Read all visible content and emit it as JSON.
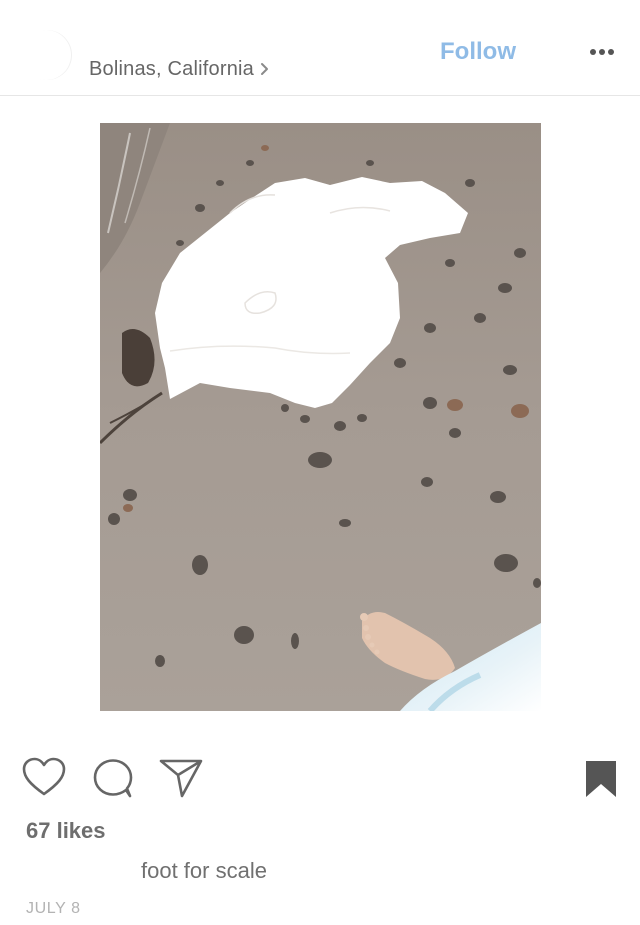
{
  "post": {
    "location": "Bolinas, California",
    "follow_label": "Follow",
    "more_icon": "more-dots-icon",
    "photo_description_icon": "beach-photo",
    "actions": {
      "like_icon": "heart-icon",
      "comment_icon": "comment-icon",
      "share_icon": "send-icon",
      "save_icon": "bookmark-icon"
    },
    "likes": "67 likes",
    "caption": "foot for scale",
    "date": "JULY 8"
  },
  "colors": {
    "follow": "#8fbbe6",
    "text_primary": "#6e6e6e",
    "text_muted": "#b3b3b3",
    "sand": "#a49a91"
  }
}
